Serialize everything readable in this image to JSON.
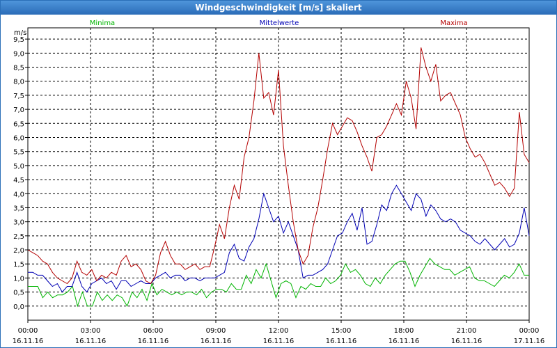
{
  "window": {
    "title": "Windgeschwindigkeit [m/s] skaliert"
  },
  "chart_data": {
    "type": "line",
    "title": "Windgeschwindigkeit [m/s] skaliert",
    "ylabel": "m/s",
    "ylim": [
      -0.5,
      9.9
    ],
    "yticks": [
      0.0,
      0.5,
      1.0,
      1.5,
      2.0,
      2.5,
      3.0,
      3.5,
      4.0,
      4.5,
      5.0,
      5.5,
      6.0,
      6.5,
      7.0,
      7.5,
      8.0,
      8.5,
      9.0,
      9.5
    ],
    "ytick_labels": [
      "0,0",
      "0,5",
      "1,0",
      "1,5",
      "2,0",
      "2,5",
      "3,0",
      "3,5",
      "4,0",
      "4,5",
      "5,0",
      "5,5",
      "6,0",
      "6,5",
      "7,0",
      "7,5",
      "8,0",
      "8,5",
      "9,0",
      "9,5"
    ],
    "xlim": [
      0,
      24
    ],
    "xticks": [
      0,
      3,
      6,
      9,
      12,
      15,
      18,
      21,
      24
    ],
    "xtick_times": [
      "00:00",
      "03:00",
      "06:00",
      "09:00",
      "12:00",
      "15:00",
      "18:00",
      "21:00",
      "00:00"
    ],
    "xtick_dates": [
      "16.11.16",
      "16.11.16",
      "16.11.16",
      "16.11.16",
      "16.11.16",
      "16.11.16",
      "16.11.16",
      "16.11.16",
      "17.11.16"
    ],
    "grid": true,
    "legend_position": "top",
    "series": [
      {
        "name": "Minima",
        "color": "#00b400",
        "values": [
          0.7,
          0.7,
          0.7,
          0.3,
          0.5,
          0.3,
          0.4,
          0.4,
          0.5,
          0.7,
          0.0,
          0.5,
          0.0,
          0.0,
          0.5,
          0.2,
          0.4,
          0.2,
          0.4,
          0.3,
          0.0,
          0.5,
          0.3,
          0.6,
          0.2,
          0.8,
          0.4,
          0.6,
          0.5,
          0.4,
          0.5,
          0.4,
          0.5,
          0.5,
          0.4,
          0.6,
          0.3,
          0.5,
          0.6,
          0.6,
          0.5,
          0.8,
          0.6,
          0.6,
          1.1,
          0.8,
          1.3,
          1.0,
          1.5,
          0.9,
          0.3,
          0.8,
          0.9,
          0.8,
          0.3,
          0.7,
          0.6,
          0.8,
          0.7,
          0.7,
          1.0,
          0.8,
          0.9,
          1.1,
          1.5,
          1.2,
          1.3,
          1.1,
          0.8,
          0.7,
          1.0,
          0.8,
          1.1,
          1.3,
          1.5,
          1.6,
          1.6,
          1.2,
          0.7,
          1.1,
          1.4,
          1.7,
          1.5,
          1.4,
          1.3,
          1.3,
          1.1,
          1.2,
          1.3,
          1.4,
          1.0,
          0.9,
          0.9,
          0.8,
          0.7,
          0.9,
          1.1,
          1.0,
          1.2,
          1.5,
          1.1,
          1.1
        ]
      },
      {
        "name": "Mittelwerte",
        "color": "#0000b4",
        "values": [
          1.2,
          1.2,
          1.1,
          1.1,
          0.9,
          0.7,
          0.8,
          0.5,
          0.7,
          0.7,
          1.2,
          0.7,
          0.5,
          0.8,
          0.9,
          1.0,
          0.8,
          0.9,
          0.6,
          0.9,
          0.9,
          0.7,
          0.8,
          0.9,
          0.8,
          0.8,
          1.0,
          1.1,
          1.2,
          1.0,
          1.1,
          1.1,
          0.9,
          1.0,
          1.0,
          0.9,
          1.0,
          1.0,
          1.0,
          1.1,
          1.2,
          1.9,
          2.2,
          1.7,
          1.6,
          2.1,
          2.4,
          3.1,
          4.0,
          3.5,
          3.0,
          3.2,
          2.6,
          3.0,
          2.5,
          2.0,
          1.0,
          1.1,
          1.1,
          1.2,
          1.3,
          1.5,
          2.0,
          2.5,
          2.6,
          3.0,
          3.3,
          2.7,
          3.5,
          2.2,
          2.3,
          2.9,
          3.6,
          3.4,
          4.0,
          4.3,
          4.0,
          3.7,
          3.4,
          4.0,
          3.8,
          3.2,
          3.6,
          3.4,
          3.1,
          3.0,
          3.1,
          3.0,
          2.7,
          2.6,
          2.5,
          2.3,
          2.2,
          2.4,
          2.2,
          2.0,
          2.2,
          2.4,
          2.1,
          2.2,
          2.6,
          3.5,
          2.5
        ]
      },
      {
        "name": "Maxima",
        "color": "#b40000",
        "values": [
          2.0,
          1.9,
          1.8,
          1.6,
          1.5,
          1.2,
          1.0,
          0.9,
          0.8,
          1.0,
          1.6,
          1.2,
          1.1,
          1.3,
          0.9,
          1.1,
          1.0,
          1.2,
          1.1,
          1.6,
          1.8,
          1.4,
          1.5,
          1.3,
          0.9,
          0.8,
          1.1,
          1.9,
          2.3,
          1.8,
          1.5,
          1.5,
          1.3,
          1.4,
          1.5,
          1.3,
          1.4,
          1.4,
          2.1,
          2.9,
          2.4,
          3.5,
          4.3,
          3.8,
          5.3,
          6.0,
          7.3,
          9.0,
          7.4,
          7.6,
          6.8,
          8.4,
          5.7,
          4.3,
          3.0,
          2.0,
          1.5,
          1.8,
          2.8,
          3.5,
          4.5,
          5.6,
          6.5,
          6.1,
          6.4,
          6.7,
          6.6,
          6.2,
          5.7,
          5.3,
          4.8,
          6.0,
          6.1,
          6.4,
          6.8,
          7.2,
          6.8,
          8.0,
          7.4,
          6.3,
          9.2,
          8.5,
          8.0,
          8.6,
          7.3,
          7.5,
          7.6,
          7.2,
          6.8,
          6.0,
          5.6,
          5.3,
          5.4,
          5.1,
          4.7,
          4.3,
          4.4,
          4.2,
          3.9,
          4.2,
          6.9,
          5.4,
          5.1
        ]
      }
    ]
  }
}
